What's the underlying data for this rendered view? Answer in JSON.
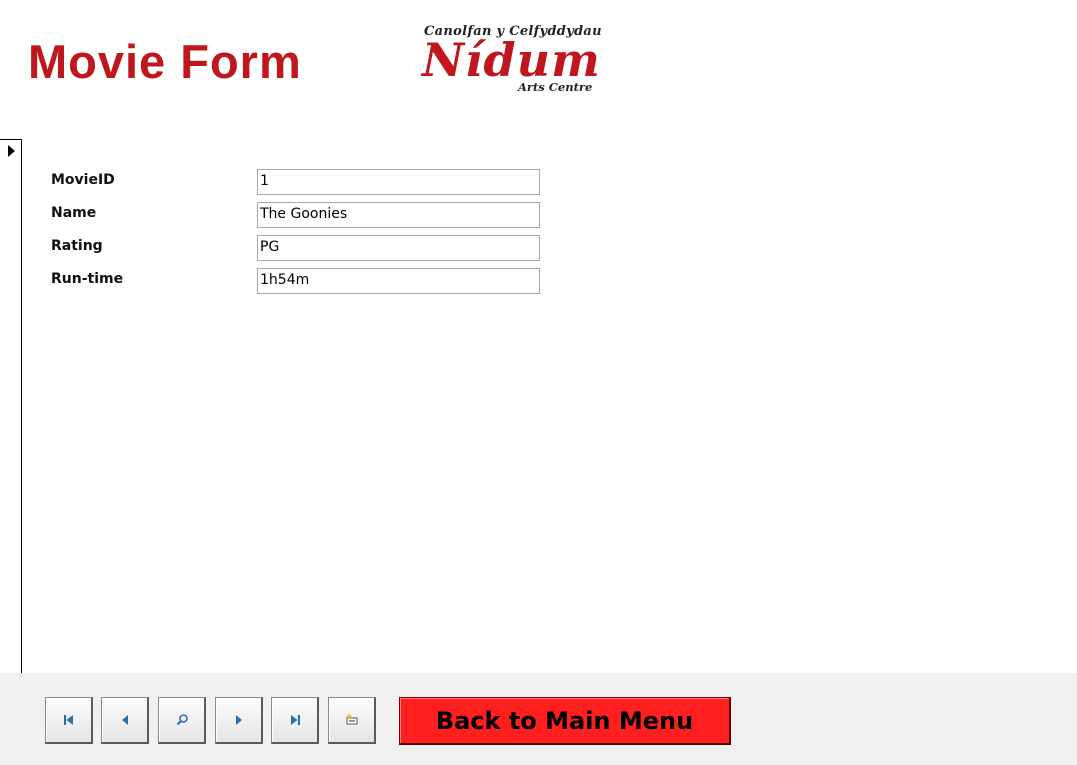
{
  "header": {
    "title": "Movie Form",
    "logo": {
      "top_text": "Canolfan y Celfyddydau",
      "main_text": "Nídum",
      "bottom_text": "Arts Centre"
    }
  },
  "form": {
    "fields": [
      {
        "label": "MovieID",
        "value": "1"
      },
      {
        "label": "Name",
        "value": "The Goonies"
      },
      {
        "label": "Rating",
        "value": "PG"
      },
      {
        "label": "Run-time",
        "value": "1h54m"
      }
    ]
  },
  "footer": {
    "nav_buttons": [
      {
        "name": "first-record",
        "icon": "first-record-icon"
      },
      {
        "name": "previous-record",
        "icon": "previous-record-icon"
      },
      {
        "name": "find-record",
        "icon": "search-icon"
      },
      {
        "name": "next-record",
        "icon": "next-record-icon"
      },
      {
        "name": "last-record",
        "icon": "last-record-icon"
      },
      {
        "name": "new-record",
        "icon": "new-record-icon"
      }
    ],
    "back_button_label": "Back to Main Menu"
  },
  "colors": {
    "title_red": "#c0161d",
    "button_red": "#ff1f1f",
    "icon_blue": "#2e6db4",
    "footer_bg": "#f0f0f0"
  }
}
